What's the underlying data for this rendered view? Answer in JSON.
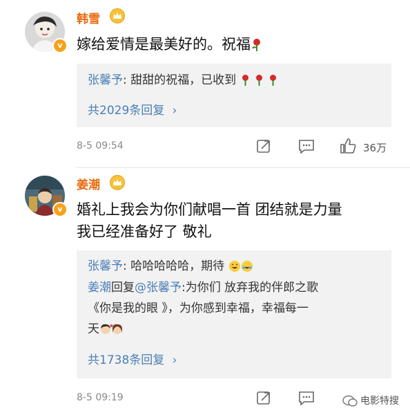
{
  "comments": [
    {
      "user": "韩雪",
      "text": "嫁给爱情是最美好的。祝福",
      "reply": {
        "author": "张馨予",
        "text": "甜甜的祝福，已收到",
        "more": "共2029条回复",
        "chevron": "›"
      },
      "time": "8-5 09:54",
      "likes": "36万"
    },
    {
      "user": "姜潮",
      "text_line1": "婚礼上我会为你们献唱一首 团结就是力量",
      "text_line2": "我已经准备好了 敬礼",
      "reply": {
        "line1_author": "张馨予",
        "line1_text": "哈哈哈哈哈，期待",
        "line2_author": "姜潮",
        "line2_mid": "回复",
        "line2_mention": "@张馨予",
        "line2_text": ":为你们 放弃我的伴郎之歌",
        "line3_text": "《你是我的眼 》，为你感到幸福，幸福每一",
        "line4_text": "天",
        "more": "共1738条回复",
        "chevron": "›"
      },
      "time": "8-5 09:19"
    }
  ],
  "watermark": "电影特搜",
  "icons": [
    "crown-icon",
    "rose-icon",
    "forward-icon",
    "comment-icon",
    "like-icon",
    "wechat-icon"
  ]
}
